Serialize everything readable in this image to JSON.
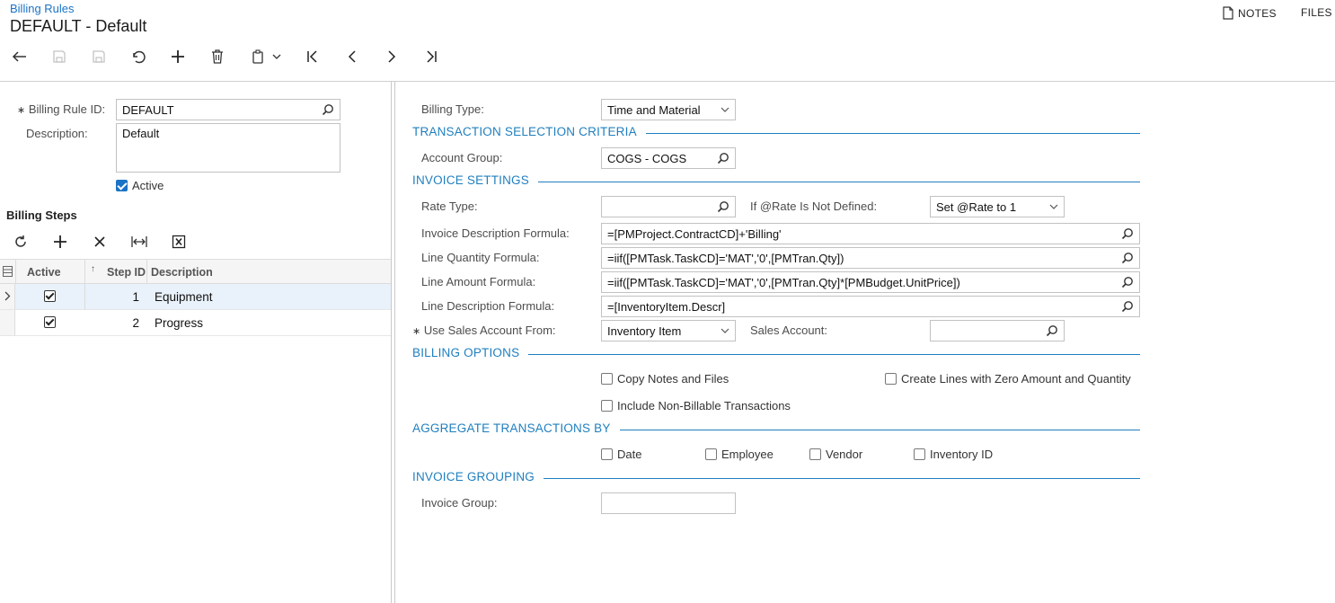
{
  "header": {
    "breadcrumb": "Billing Rules",
    "title": "DEFAULT - Default",
    "notes_label": "NOTES",
    "files_label": "FILES"
  },
  "form": {
    "billing_rule_id_label": "Billing Rule ID:",
    "billing_rule_id_value": "DEFAULT",
    "description_label": "Description:",
    "description_value": "Default",
    "active_label": "Active",
    "active_checked": true
  },
  "billing_steps": {
    "title": "Billing Steps",
    "columns": {
      "active": "Active",
      "step_id": "Step ID",
      "description": "Description"
    },
    "rows": [
      {
        "active": true,
        "step_id": "1",
        "description": "Equipment",
        "selected": true
      },
      {
        "active": true,
        "step_id": "2",
        "description": "Progress",
        "selected": false
      }
    ]
  },
  "details": {
    "billing_type_label": "Billing Type:",
    "billing_type_value": "Time and Material",
    "sections": {
      "transaction_selection": "TRANSACTION SELECTION CRITERIA",
      "invoice_settings": "INVOICE SETTINGS",
      "billing_options": "BILLING OPTIONS",
      "aggregate_by": "AGGREGATE TRANSACTIONS BY",
      "invoice_grouping": "INVOICE GROUPING"
    },
    "account_group_label": "Account Group:",
    "account_group_value": "COGS - COGS",
    "rate_type_label": "Rate Type:",
    "rate_type_value": "",
    "rate_not_defined_label": "If @Rate Is Not Defined:",
    "rate_not_defined_value": "Set @Rate to 1",
    "invoice_desc_formula_label": "Invoice Description Formula:",
    "invoice_desc_formula_value": "=[PMProject.ContractCD]+'Billing'",
    "line_qty_formula_label": "Line Quantity Formula:",
    "line_qty_formula_value": "=iif([PMTask.TaskCD]='MAT','0',[PMTran.Qty])",
    "line_amount_formula_label": "Line Amount Formula:",
    "line_amount_formula_value": "=iif([PMTask.TaskCD]='MAT','0',[PMTran.Qty]*[PMBudget.UnitPrice])",
    "line_desc_formula_label": "Line Description Formula:",
    "line_desc_formula_value": "=[InventoryItem.Descr]",
    "use_sales_account_label": "Use Sales Account From:",
    "use_sales_account_value": "Inventory Item",
    "sales_account_label": "Sales Account:",
    "sales_account_value": "",
    "copy_notes_label": "Copy Notes and Files",
    "zero_amount_label": "Create Lines with Zero Amount and Quantity",
    "non_billable_label": "Include Non-Billable Transactions",
    "agg_date_label": "Date",
    "agg_employee_label": "Employee",
    "agg_vendor_label": "Vendor",
    "agg_inventory_label": "Inventory ID",
    "invoice_group_label": "Invoice Group:",
    "invoice_group_value": ""
  },
  "colors": {
    "accent": "#1f7fbf",
    "link": "#1a73c6",
    "selected_row": "#e9f1fa"
  }
}
